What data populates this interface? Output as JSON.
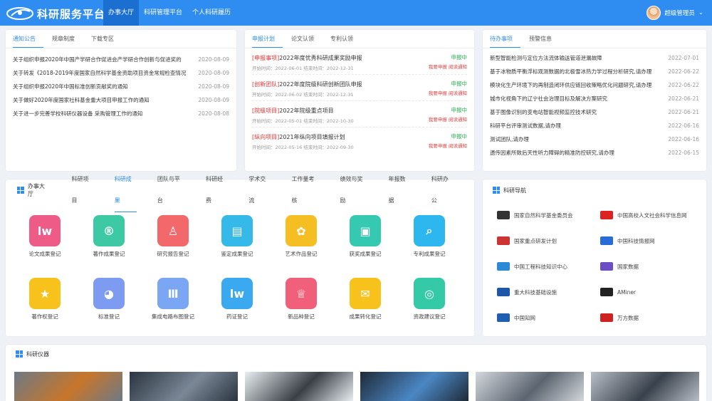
{
  "header": {
    "brand": "科研服务平台",
    "nav": [
      "办事大厅",
      "科研管理平台",
      "个人科研履历"
    ],
    "user": "超级管理员",
    "chevron": "⌄"
  },
  "notices": {
    "tabs": [
      "通知公告",
      "规章制度",
      "下载专区"
    ],
    "items": [
      {
        "title": "关于组织申报2020年中国产学研合作促进会产学研合作创新与促进奖的",
        "date": "2020-08-09"
      },
      {
        "title": "关于转发《2018-2019年度国家自然科学基金资助项目资金常规检查情况",
        "date": "2020-08-09"
      },
      {
        "title": "关于组织申报2020年中国标准创新贡献奖的通知",
        "date": "2020-08-09"
      },
      {
        "title": "关于做好2020年度国家社科基金重大项目申报工作的通知",
        "date": "2020-08-09"
      },
      {
        "title": "关于进一步完善学校科研仪器设备 采购管理工作的通知",
        "date": "2020-08-08"
      }
    ]
  },
  "projects": {
    "tabs": [
      "申报计划",
      "论文认领",
      "专利认领"
    ],
    "items": [
      {
        "tag": "[申报事项]",
        "title": "2022年度优秀科研成果奖励申报",
        "meta": "开始时间：2022-06-01  结束时间：2022-12-31",
        "status": "申报中",
        "actions": "我要申报   阅读通知"
      },
      {
        "tag": "[创新团队]",
        "title": "2022年度院级科研创新团队申报",
        "meta": "开始时间：2022-06-02  结束时间：2022-12-31",
        "status": "申报中",
        "actions": "我要申报   阅读通知"
      },
      {
        "tag": "[院级项目]",
        "title": "2022年院级重点项目",
        "meta": "开始时间：2022-05-01  结束时间：2022-10-30",
        "status": "申报中",
        "actions": "我要申报   阅读通知"
      },
      {
        "tag": "[纵向项目]",
        "title": "2021年纵向项目填报计划",
        "meta": "开始时间：2022-05-16  结束时间：2022-09-30",
        "status": "申报中",
        "actions": "我要申报   阅读通知"
      }
    ]
  },
  "todos": {
    "tabs": [
      "待办事项",
      "预警信息"
    ],
    "items": [
      {
        "title": "新型智能检测与定位方法流体输送管道泄漏故障",
        "date": "2022-07-01"
      },
      {
        "title": "基于冰物质平衡浮标观测数据的北极雪冰热力学过程分析研究,请办理",
        "date": "2022-06-22"
      },
      {
        "title": "模块化生产环境下的再制造闭环供应链回收策略优化问题研究,请办理",
        "date": "2022-06-22"
      },
      {
        "title": "城市化视角下的辽宁社会治理目标及解决方案研究",
        "date": "2022-06-21"
      },
      {
        "title": "基于图像识别的变电站智能视频监控技术研究",
        "date": "2022-06-21"
      },
      {
        "title": "科研平台评审测试数据,请办理",
        "date": "2022-06-16"
      },
      {
        "title": "测试团队,请办理",
        "date": "2022-06-16"
      },
      {
        "title": "遗传因素所致后天性听力障碍的精准防控研究,请办理",
        "date": "2022-06-15"
      }
    ]
  },
  "hall": {
    "title": "办事大厅",
    "tabs": [
      "科研项目",
      "科研成果",
      "团队与平台",
      "科研经费",
      "学术交流",
      "工作量考核",
      "绩效与奖励",
      "年报数据",
      "科研办公"
    ],
    "apps": [
      {
        "label": "论文成果登记",
        "glyph": "lw",
        "color": "#ef5b87"
      },
      {
        "label": "著作成果登记",
        "glyph": "®",
        "color": "#3dc9a4"
      },
      {
        "label": "研究报告登记",
        "glyph": "♙",
        "color": "#f3696b"
      },
      {
        "label": "鉴定成果登记",
        "glyph": "▤",
        "color": "#34b9e8"
      },
      {
        "label": "艺术作品登记",
        "glyph": "✿",
        "color": "#f5be23"
      },
      {
        "label": "获奖成果登记",
        "glyph": "▣",
        "color": "#34c9b0"
      },
      {
        "label": "专利成果登记",
        "glyph": "⌕",
        "color": "#2eb6ee"
      },
      {
        "label": "著作权登记",
        "glyph": "★",
        "color": "#f7c21c"
      },
      {
        "label": "标准登记",
        "glyph": "◕",
        "color": "#7d9bf0"
      },
      {
        "label": "集成电路布图登记",
        "glyph": "Ⅲ",
        "color": "#7ba6f4"
      },
      {
        "label": "药证登记",
        "glyph": "lw",
        "color": "#3aa9f0"
      },
      {
        "label": "新品种登记",
        "glyph": "♕",
        "color": "#f1607a"
      },
      {
        "label": "成果转化登记",
        "glyph": "✉",
        "color": "#f7c21c"
      },
      {
        "label": "资政建议登记",
        "glyph": "◎",
        "color": "#34c9a7"
      }
    ]
  },
  "links": {
    "title": "科研导航",
    "items": [
      {
        "label": "国家自然科学基金委员会",
        "color": "#333"
      },
      {
        "label": "中国高校人文社会科学信息网",
        "color": "#d22"
      },
      {
        "label": "国家重点研发计划",
        "color": "#c33"
      },
      {
        "label": "中国科技情报网",
        "color": "#2a6cd6"
      },
      {
        "label": "中国工程科技知识中心",
        "color": "#2a8ad6"
      },
      {
        "label": "国家数据",
        "color": "#6a4fc4"
      },
      {
        "label": "重大科技基础设施",
        "color": "#1e56a8"
      },
      {
        "label": "AMiner",
        "color": "#222"
      },
      {
        "label": "中国知网",
        "color": "#1e5fb0"
      },
      {
        "label": "万方数据",
        "color": "#c22"
      }
    ]
  },
  "instruments": {
    "title": "科研仪器"
  }
}
